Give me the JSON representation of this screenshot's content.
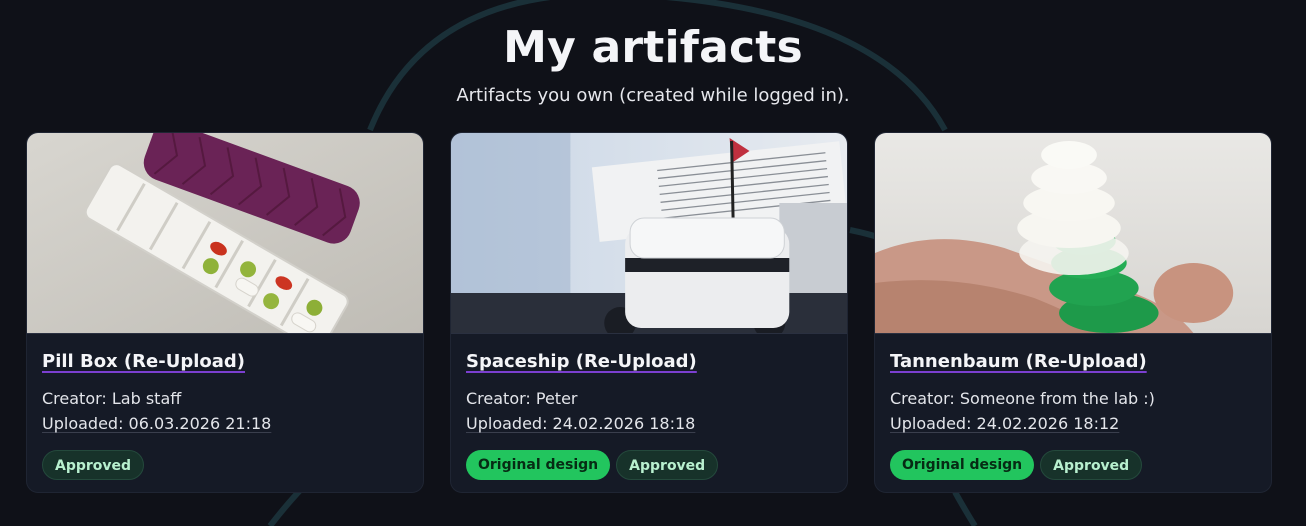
{
  "header": {
    "title": "My artifacts",
    "subtitle": "Artifacts you own (created while logged in)."
  },
  "cards": [
    {
      "title": "Pill Box (Re-Upload)",
      "creator": "Creator: Lab staff",
      "uploaded": "Uploaded: 06.03.2026 21:18",
      "badges": [
        "Approved"
      ]
    },
    {
      "title": "Spaceship (Re-Upload)",
      "creator": "Creator: Peter",
      "uploaded": "Uploaded: 24.02.2026 18:18",
      "badges": [
        "Original design",
        "Approved"
      ]
    },
    {
      "title": "Tannenbaum (Re-Upload)",
      "creator": "Creator: Someone from the lab :)",
      "uploaded": "Uploaded: 24.02.2026 18:12",
      "badges": [
        "Original design",
        "Approved"
      ]
    }
  ],
  "colors": {
    "background": "#0f1118",
    "card": "#151a26",
    "original_badge": "#22c55e",
    "approved_badge": "#17322a",
    "title_underline": "#7b3fd0"
  }
}
